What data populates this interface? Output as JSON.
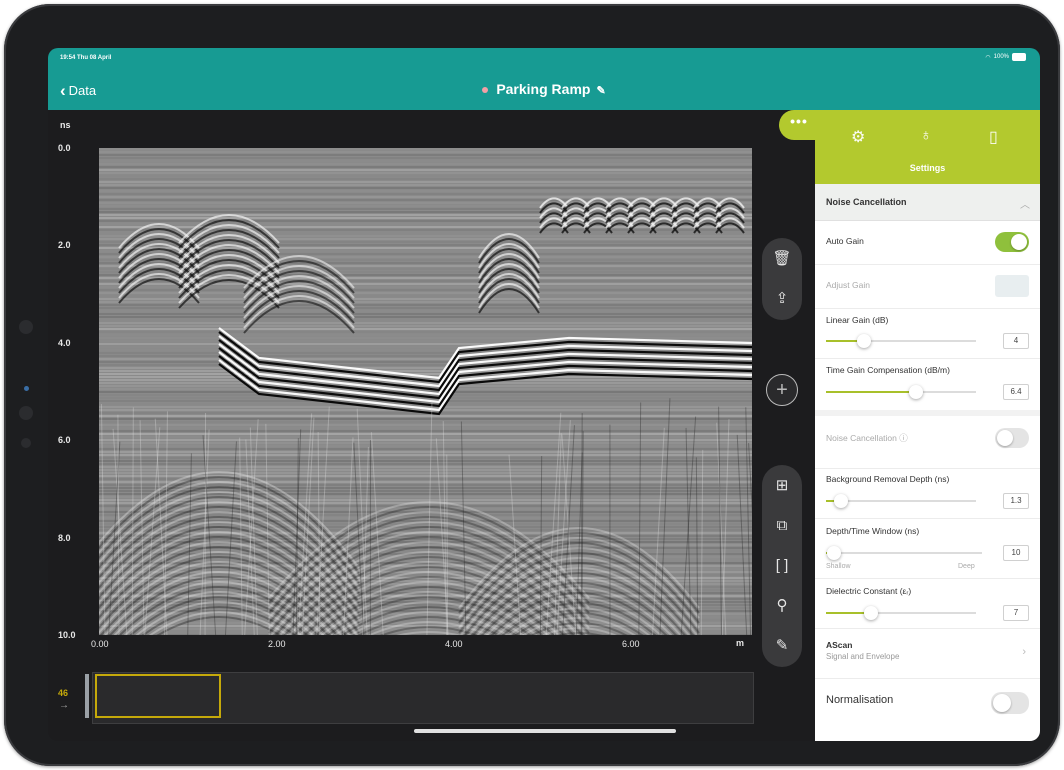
{
  "status": {
    "time": "19:54 Thu 08 April",
    "battery": "100%"
  },
  "header": {
    "back_label": "Data",
    "title": "Parking Ramp"
  },
  "plot": {
    "y_unit": "ns",
    "y_ticks": [
      "0.0",
      "2.0",
      "4.0",
      "6.0",
      "8.0",
      "10.0"
    ],
    "x_ticks": [
      "0.00",
      "2.00",
      "4.00",
      "6.00"
    ],
    "x_unit": "m"
  },
  "minimap": {
    "trace_number": "46",
    "arrow": "→"
  },
  "toolbar_top": [
    {
      "icon": "trash-icon",
      "glyph": "🗑"
    },
    {
      "icon": "share-icon",
      "glyph": "⇪"
    }
  ],
  "toolbar_bottom": [
    {
      "icon": "overlay-icon",
      "glyph": "⊞"
    },
    {
      "icon": "image-compare-icon",
      "glyph": "⧉"
    },
    {
      "icon": "bracket-icon",
      "glyph": "[ ]"
    },
    {
      "icon": "marker-icon",
      "glyph": "⚲"
    },
    {
      "icon": "draw-icon",
      "glyph": "✎"
    }
  ],
  "settings": {
    "tab_label": "Settings",
    "section_title": "Noise Cancellation",
    "auto_gain": {
      "label": "Auto Gain",
      "on": true
    },
    "adjust_gain": {
      "label": "Adjust Gain"
    },
    "linear_gain": {
      "label": "Linear Gain (dB)",
      "value": "4",
      "level": 0.25
    },
    "tgc": {
      "label": "Time Gain Compensation (dB/m)",
      "value": "6.4",
      "level": 0.6
    },
    "noise_cancellation": {
      "label": "Noise Cancellation ⓘ",
      "on": false
    },
    "bg_removal": {
      "label": "Background Removal Depth (ns)",
      "value": "1.3",
      "level": 0.1
    },
    "depth_window": {
      "label": "Depth/Time Window (ns)",
      "value": "10",
      "level": 0.05,
      "min_label": "Shallow",
      "max_label": "Deep"
    },
    "dielectric": {
      "label": "Dielectric Constant (εᵣ)",
      "value": "7",
      "level": 0.3
    },
    "ascan": {
      "label": "AScan",
      "sub": "Signal and Envelope"
    },
    "normalisation": {
      "label": "Normalisation",
      "on": false
    }
  },
  "colors": {
    "teal": "#179b93",
    "lime": "#b3c92e",
    "toggle_on": "#8fc03c",
    "mini_select": "#c5a90a"
  }
}
